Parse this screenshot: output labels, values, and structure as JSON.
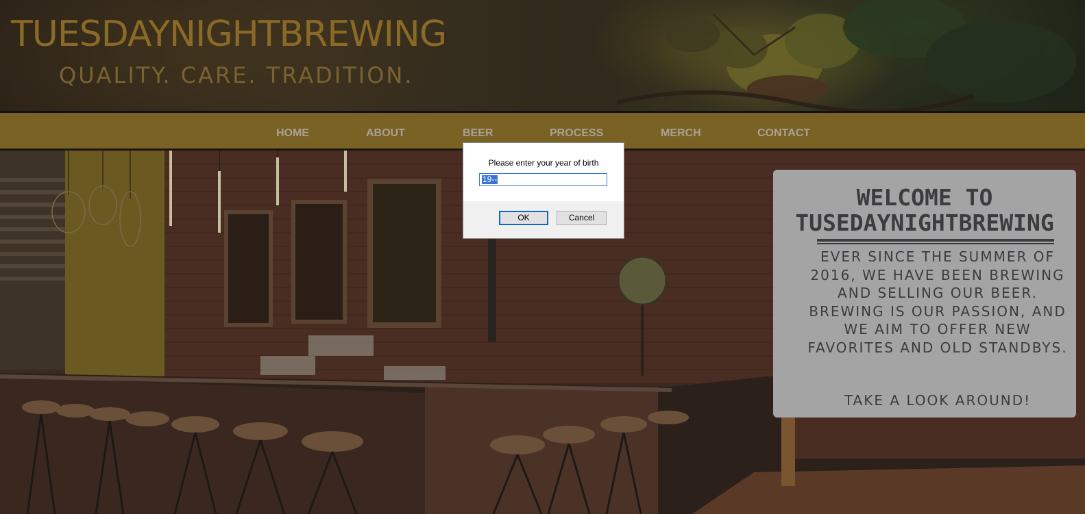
{
  "header": {
    "brand": "TUESDAYNIGHTBREWING",
    "tagline": "QUALITY. CARE. TRADITION."
  },
  "nav": {
    "items": [
      "HOME",
      "ABOUT",
      "BEER",
      "PROCESS",
      "MERCH",
      "CONTACT"
    ]
  },
  "welcome": {
    "title_line1": "WELCOME TO",
    "title_line2": "TUSEDAYNIGHTBREWING",
    "body": "EVER SINCE THE SUMMER OF 2016, WE HAVE BEEN BREWING AND SELLING OUR BEER. BREWING IS OUR PASSION, AND WE AIM TO OFFER NEW FAVORITES AND OLD STANDBYS.",
    "cta": "TAKE A LOOK AROUND!"
  },
  "dialog": {
    "message": "Please enter your year of birth",
    "input_value": "19--",
    "ok_label": "OK",
    "cancel_label": "Cancel"
  },
  "colors": {
    "brand_gold": "#8a6a26",
    "nav_bar": "#7a6124",
    "nav_text": "#a8a296",
    "card_bg": "#a4a4a4",
    "card_text": "#3c3c40",
    "dialog_focus": "#0a64d2"
  }
}
